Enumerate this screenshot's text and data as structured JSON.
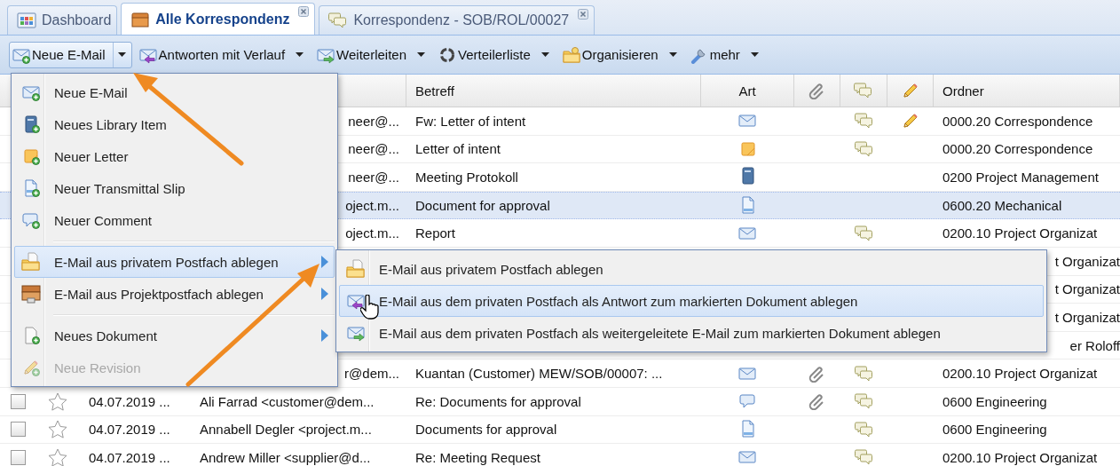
{
  "tabs": [
    {
      "label": "Dashboard",
      "kind": "dashboard",
      "selected": false,
      "closable": false
    },
    {
      "label": "Alle Korrespondenz",
      "kind": "box",
      "selected": true,
      "closable": true
    },
    {
      "label": "Korrespondenz - SOB/ROL/00027",
      "kind": "bubbles",
      "selected": false,
      "closable": true
    }
  ],
  "toolbar": [
    {
      "label": "Neue E-Mail",
      "kind": "new-mail",
      "pressed": true
    },
    {
      "label": "Antworten mit Verlauf",
      "kind": "reply-mail",
      "pressed": false
    },
    {
      "label": "Weiterleiten",
      "kind": "forward-mail",
      "pressed": false
    },
    {
      "label": "Verteilerliste",
      "kind": "distribution",
      "pressed": false
    },
    {
      "label": "Organisieren",
      "kind": "organize",
      "pressed": false
    },
    {
      "label": "mehr",
      "kind": "more",
      "pressed": false
    }
  ],
  "grid": {
    "columns": [
      {
        "kind": "text",
        "label": "Betreff"
      },
      {
        "kind": "text",
        "label": "Art"
      },
      {
        "kind": "attachment"
      },
      {
        "kind": "comment"
      },
      {
        "kind": "edit"
      },
      {
        "kind": "text",
        "label": "Ordner"
      }
    ],
    "rows": [
      {
        "sender": "neer@...",
        "subject": "Fw: Letter of intent",
        "kind": "mail",
        "attachment": false,
        "comment": true,
        "edited": true,
        "folder": "0000.20 Correspondence",
        "selected": false
      },
      {
        "sender": "neer@...",
        "subject": "Letter of intent",
        "kind": "letter",
        "attachment": false,
        "comment": true,
        "edited": false,
        "folder": "0000.20 Correspondence",
        "selected": false
      },
      {
        "sender": "neer@...",
        "subject": "Meeting Protokoll",
        "kind": "library",
        "attachment": false,
        "comment": false,
        "edited": false,
        "folder": "0200 Project Management",
        "selected": false
      },
      {
        "sender": "oject.m...",
        "subject": "Document for approval",
        "kind": "document",
        "attachment": false,
        "comment": false,
        "edited": false,
        "folder": "0600.20 Mechanical",
        "selected": true
      },
      {
        "sender": "oject.m...",
        "subject": "Report",
        "kind": "mail",
        "attachment": false,
        "comment": true,
        "edited": false,
        "folder": "0200.10 Project Organizat",
        "selected": false
      },
      {
        "folder": "t Organizat",
        "selected": false
      },
      {
        "folder": "t Organizat",
        "selected": false
      },
      {
        "folder": "t Organizat",
        "selected": false
      },
      {
        "folder": "er Roloff",
        "selected": false
      },
      {
        "sender": "r@dem...",
        "subject": "Kuantan (Customer) MEW/SOB/00007: ...",
        "kind": "mail",
        "attachment": true,
        "comment": true,
        "edited": false,
        "folder": "0200.10 Project Organizat",
        "selected": false
      },
      {
        "checked": false,
        "starred": false,
        "date": "04.07.2019 ...",
        "sender": "Ali Farrad <customer@dem...",
        "subject": "Re: Documents for approval",
        "kind": "comment",
        "attachment": true,
        "comment": true,
        "edited": false,
        "folder": "0600 Engineering",
        "selected": false
      },
      {
        "checked": false,
        "starred": false,
        "date": "04.07.2019 ...",
        "sender": "Annabell Degler <project.m...",
        "subject": "Documents for approval",
        "kind": "document",
        "attachment": false,
        "comment": true,
        "edited": false,
        "folder": "0600 Engineering",
        "selected": false
      },
      {
        "checked": false,
        "starred": false,
        "date": "04.07.2019 ...",
        "sender": "Andrew Miller <supplier@d...",
        "subject": "Re: Meeting Request",
        "kind": "mail",
        "attachment": false,
        "comment": true,
        "edited": false,
        "folder": "0200.10 Project Organizat",
        "selected": false
      }
    ]
  },
  "menu": {
    "items": [
      {
        "kind": "new-mail",
        "label": "Neue E-Mail",
        "submenu": false,
        "disabled": false,
        "selected": false
      },
      {
        "kind": "library-new",
        "label": "Neues Library Item",
        "submenu": false,
        "disabled": false,
        "selected": false
      },
      {
        "kind": "letter-new",
        "label": "Neuer Letter",
        "submenu": false,
        "disabled": false,
        "selected": false
      },
      {
        "kind": "transmittal-new",
        "label": "Neuer Transmittal Slip",
        "submenu": false,
        "disabled": false,
        "selected": false
      },
      {
        "kind": "comment-new",
        "label": "Neuer Comment",
        "submenu": false,
        "disabled": false,
        "selected": false
      },
      {
        "kind": "separator"
      },
      {
        "kind": "folder-doc",
        "label": "E-Mail aus privatem Postfach ablegen",
        "submenu": true,
        "disabled": false,
        "selected": true
      },
      {
        "kind": "archive",
        "label": "E-Mail aus Projektpostfach ablegen",
        "submenu": true,
        "disabled": false,
        "selected": false
      },
      {
        "kind": "separator"
      },
      {
        "kind": "document-new",
        "label": "Neues Dokument",
        "submenu": true,
        "disabled": false,
        "selected": false
      },
      {
        "kind": "revision-new",
        "label": "Neue Revision",
        "submenu": false,
        "disabled": true,
        "selected": false
      }
    ]
  },
  "submenu": {
    "items": [
      {
        "kind": "folder-doc",
        "label": "E-Mail aus privatem Postfach ablegen",
        "submenu": false,
        "disabled": false,
        "selected": false
      },
      {
        "kind": "reply-mail",
        "label": "E-Mail aus dem privaten Postfach als Antwort zum markierten Dokument ablegen",
        "submenu": false,
        "disabled": false,
        "selected": true
      },
      {
        "kind": "forward-mail",
        "label": "E-Mail aus dem privaten Postfach als weitergeleitete E-Mail zum markierten Dokument ablegen",
        "submenu": false,
        "disabled": false,
        "selected": false
      }
    ]
  }
}
